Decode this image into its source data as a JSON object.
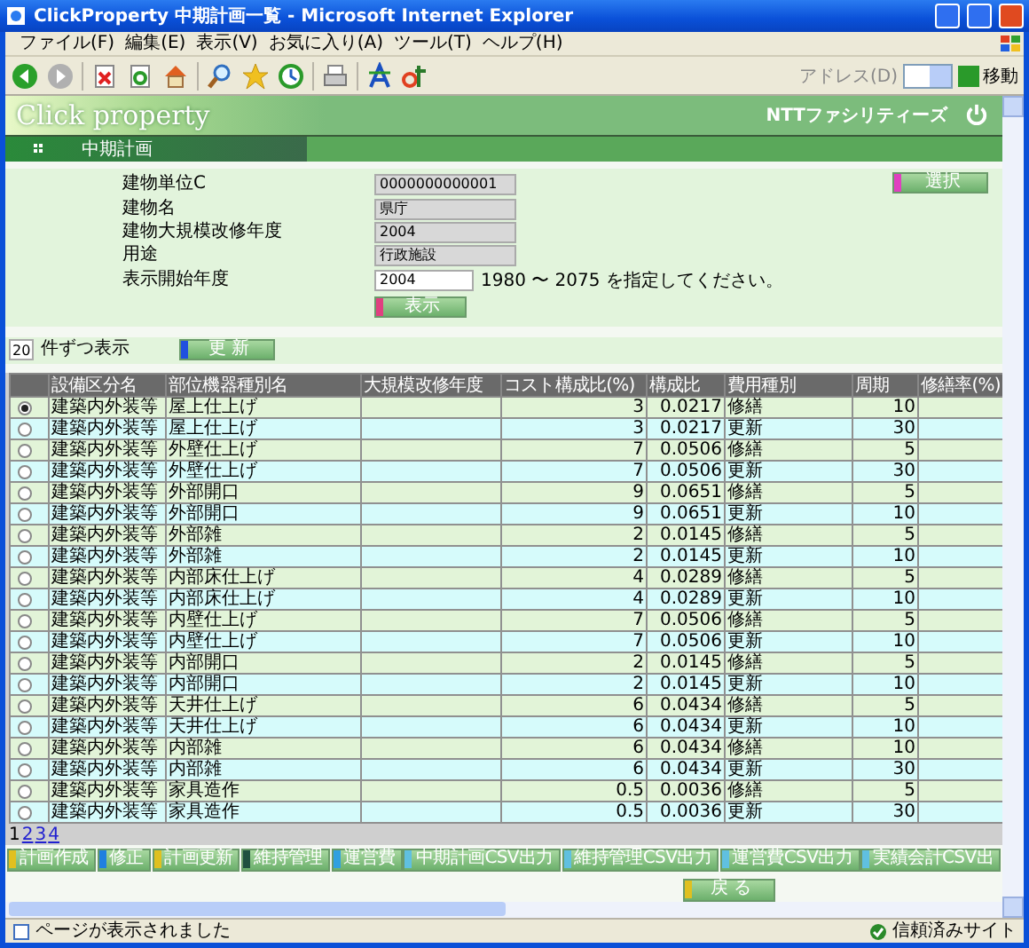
{
  "window": {
    "title": "ClickProperty 中期計画一覧 - Microsoft Internet Explorer"
  },
  "menu": [
    "ファイル(F)",
    "編集(E)",
    "表示(V)",
    "お気に入り(A)",
    "ツール(T)",
    "ヘルプ(H)"
  ],
  "address": {
    "label": "アドレス(D)",
    "go": "移動"
  },
  "header": {
    "logo": "Click property",
    "company": "NTTファシリティーズ",
    "section": "中期計画"
  },
  "form": {
    "fields": [
      {
        "label": "建物単位C",
        "value": "0000000000001",
        "kind": "readonly"
      },
      {
        "label": "建物名",
        "value": "県庁",
        "kind": "readonly"
      },
      {
        "label": "建物大規模改修年度",
        "value": "2004",
        "kind": "readonly"
      },
      {
        "label": "用途",
        "value": "行政施設",
        "kind": "readonly"
      },
      {
        "label": "表示開始年度",
        "value": "2004",
        "kind": "input",
        "hint": "1980 〜 2075 を指定してください。"
      }
    ],
    "select_button": {
      "label": "選択",
      "color": "#e040c0"
    },
    "show_button": {
      "label": "表示",
      "color": "#e04080"
    }
  },
  "paging": {
    "count": "20",
    "label": "件ずつ表示",
    "button": {
      "label": "更 新",
      "color": "#2050e0"
    }
  },
  "table": {
    "columns": [
      "設備区分名",
      "部位機器種別名",
      "大規模改修年度",
      "コスト構成比(%)",
      "構成比",
      "費用種別",
      "周期",
      "修繕率(%)"
    ],
    "rows": [
      {
        "selected": true,
        "category": "建築内外装等",
        "part": "屋上仕上げ",
        "cost_ratio": "3",
        "ratio": "0.0217",
        "cost_type": "修繕",
        "cycle": "10"
      },
      {
        "selected": false,
        "category": "建築内外装等",
        "part": "屋上仕上げ",
        "cost_ratio": "3",
        "ratio": "0.0217",
        "cost_type": "更新",
        "cycle": "30"
      },
      {
        "selected": false,
        "category": "建築内外装等",
        "part": "外壁仕上げ",
        "cost_ratio": "7",
        "ratio": "0.0506",
        "cost_type": "修繕",
        "cycle": "5"
      },
      {
        "selected": false,
        "category": "建築内外装等",
        "part": "外壁仕上げ",
        "cost_ratio": "7",
        "ratio": "0.0506",
        "cost_type": "更新",
        "cycle": "30"
      },
      {
        "selected": false,
        "category": "建築内外装等",
        "part": "外部開口",
        "cost_ratio": "9",
        "ratio": "0.0651",
        "cost_type": "修繕",
        "cycle": "5"
      },
      {
        "selected": false,
        "category": "建築内外装等",
        "part": "外部開口",
        "cost_ratio": "9",
        "ratio": "0.0651",
        "cost_type": "更新",
        "cycle": "10"
      },
      {
        "selected": false,
        "category": "建築内外装等",
        "part": "外部雑",
        "cost_ratio": "2",
        "ratio": "0.0145",
        "cost_type": "修繕",
        "cycle": "5"
      },
      {
        "selected": false,
        "category": "建築内外装等",
        "part": "外部雑",
        "cost_ratio": "2",
        "ratio": "0.0145",
        "cost_type": "更新",
        "cycle": "10"
      },
      {
        "selected": false,
        "category": "建築内外装等",
        "part": "内部床仕上げ",
        "cost_ratio": "4",
        "ratio": "0.0289",
        "cost_type": "修繕",
        "cycle": "5"
      },
      {
        "selected": false,
        "category": "建築内外装等",
        "part": "内部床仕上げ",
        "cost_ratio": "4",
        "ratio": "0.0289",
        "cost_type": "更新",
        "cycle": "10"
      },
      {
        "selected": false,
        "category": "建築内外装等",
        "part": "内壁仕上げ",
        "cost_ratio": "7",
        "ratio": "0.0506",
        "cost_type": "修繕",
        "cycle": "5"
      },
      {
        "selected": false,
        "category": "建築内外装等",
        "part": "内壁仕上げ",
        "cost_ratio": "7",
        "ratio": "0.0506",
        "cost_type": "更新",
        "cycle": "10"
      },
      {
        "selected": false,
        "category": "建築内外装等",
        "part": "内部開口",
        "cost_ratio": "2",
        "ratio": "0.0145",
        "cost_type": "修繕",
        "cycle": "5"
      },
      {
        "selected": false,
        "category": "建築内外装等",
        "part": "内部開口",
        "cost_ratio": "2",
        "ratio": "0.0145",
        "cost_type": "更新",
        "cycle": "10"
      },
      {
        "selected": false,
        "category": "建築内外装等",
        "part": "天井仕上げ",
        "cost_ratio": "6",
        "ratio": "0.0434",
        "cost_type": "修繕",
        "cycle": "5"
      },
      {
        "selected": false,
        "category": "建築内外装等",
        "part": "天井仕上げ",
        "cost_ratio": "6",
        "ratio": "0.0434",
        "cost_type": "更新",
        "cycle": "10"
      },
      {
        "selected": false,
        "category": "建築内外装等",
        "part": "内部雑",
        "cost_ratio": "6",
        "ratio": "0.0434",
        "cost_type": "修繕",
        "cycle": "10"
      },
      {
        "selected": false,
        "category": "建築内外装等",
        "part": "内部雑",
        "cost_ratio": "6",
        "ratio": "0.0434",
        "cost_type": "更新",
        "cycle": "30"
      },
      {
        "selected": false,
        "category": "建築内外装等",
        "part": "家具造作",
        "cost_ratio": "0.5",
        "ratio": "0.0036",
        "cost_type": "修繕",
        "cycle": "5"
      },
      {
        "selected": false,
        "category": "建築内外装等",
        "part": "家具造作",
        "cost_ratio": "0.5",
        "ratio": "0.0036",
        "cost_type": "更新",
        "cycle": "30"
      }
    ]
  },
  "pages": [
    {
      "label": "1",
      "selected": true
    },
    {
      "label": "2",
      "selected": false
    },
    {
      "label": "3",
      "selected": false
    },
    {
      "label": "4",
      "selected": false
    }
  ],
  "actions": [
    {
      "label": "計画作成",
      "color": "#e0c020"
    },
    {
      "label": "修正",
      "color": "#2080e0"
    },
    {
      "label": "計画更新",
      "color": "#e0c020"
    },
    {
      "label": "維持管理",
      "color": "#205040"
    },
    {
      "label": "運営費",
      "color": "#30a0e0"
    },
    {
      "label": "中期計画CSV出力",
      "color": "#60c0e0"
    },
    {
      "label": "維持管理CSV出力",
      "color": "#60c0e0"
    },
    {
      "label": "運営費CSV出力",
      "color": "#60c0e0"
    },
    {
      "label": "実績会計CSV出",
      "color": "#60c0e0"
    }
  ],
  "back_button": {
    "label": "戻 る",
    "color": "#e0c020"
  },
  "status": {
    "text": "ページが表示されました",
    "zone": "信頼済みサイト"
  }
}
